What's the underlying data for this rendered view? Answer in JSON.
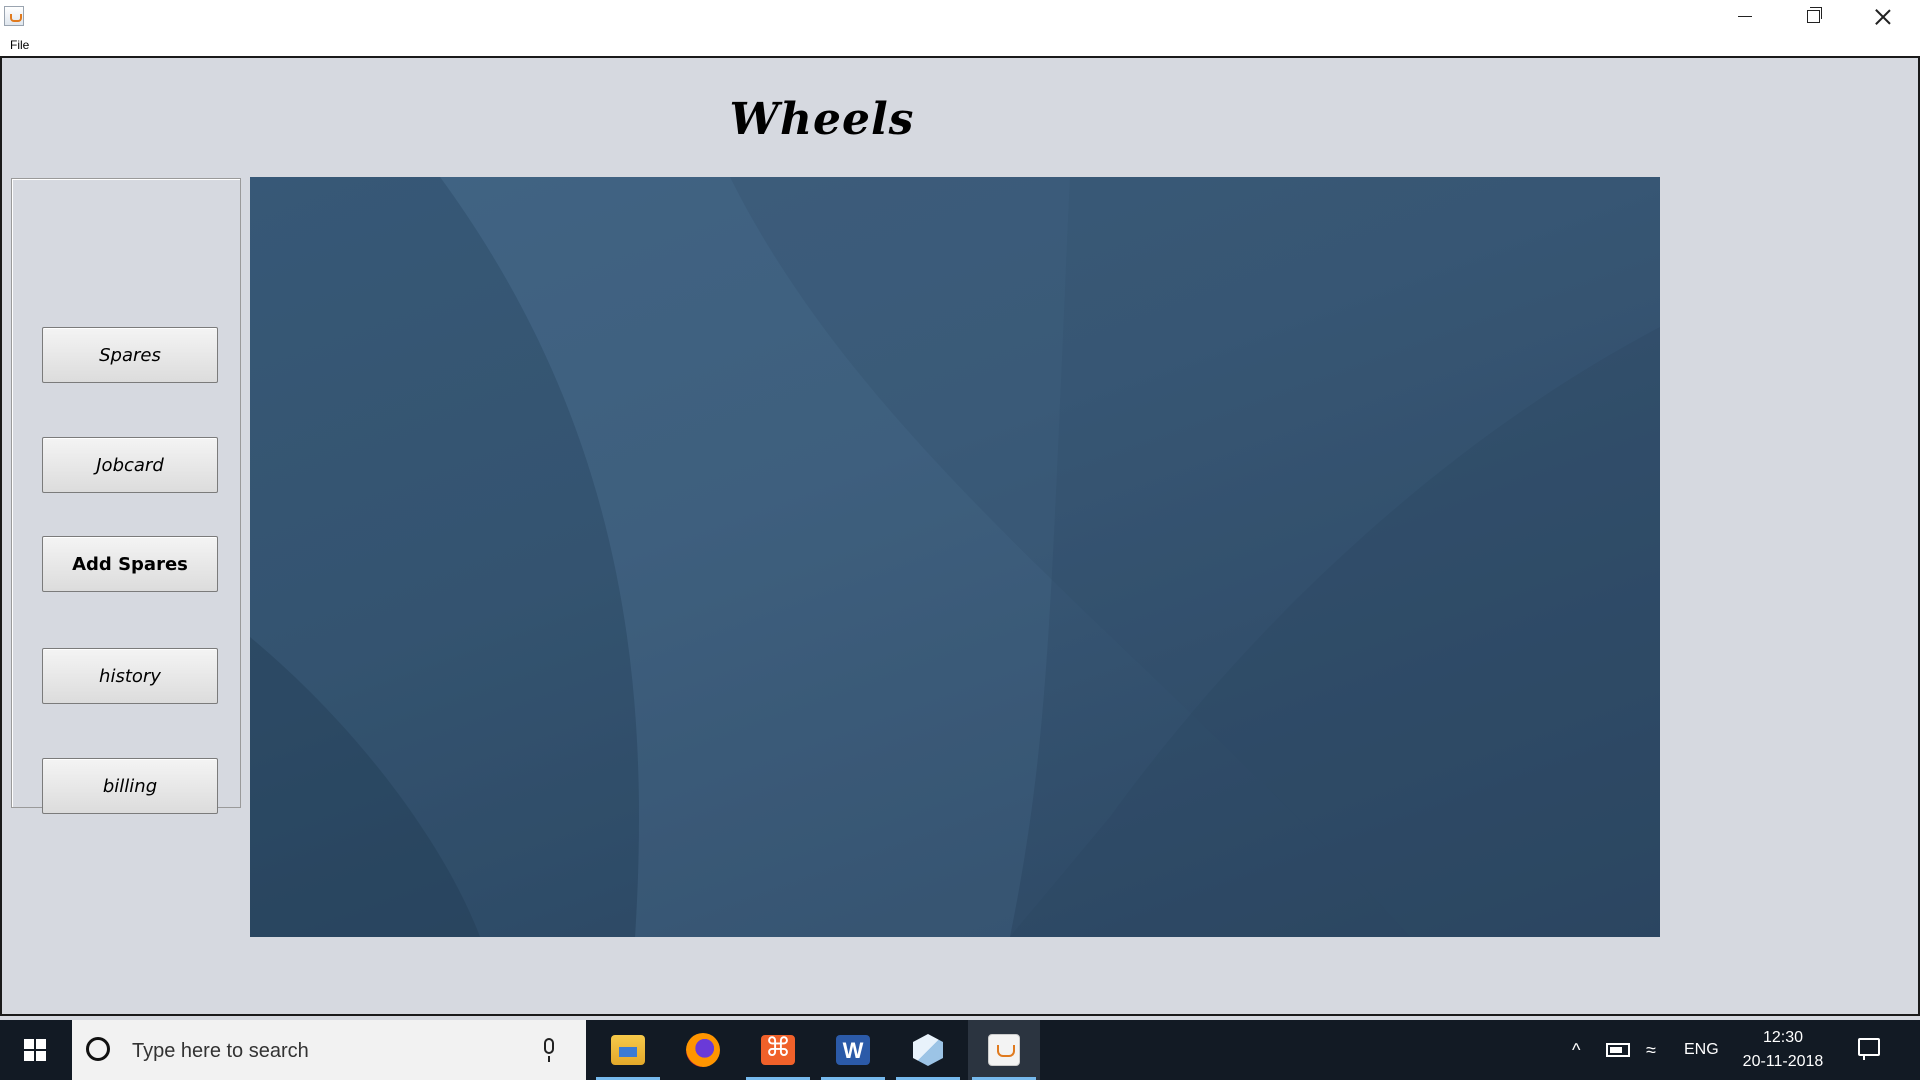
{
  "window": {
    "menu": [
      "File"
    ]
  },
  "app": {
    "title": "Wheels",
    "nav_buttons": [
      "Spares",
      "Jobcard",
      "Add Spares",
      "history",
      "billing"
    ]
  },
  "taskbar": {
    "search_placeholder": "Type here to search",
    "pinned_apps": [
      "file-explorer-icon",
      "firefox-icon",
      "xampp-icon",
      "word-icon",
      "cube-app-icon",
      "java-icon"
    ],
    "tray": {
      "language": "ENG",
      "time": "12:30",
      "date": "20-11-2018"
    }
  },
  "colors": {
    "frame_background": "#d6d9e0",
    "image_blue": "#3a5a78",
    "taskbar": "#121a24"
  }
}
